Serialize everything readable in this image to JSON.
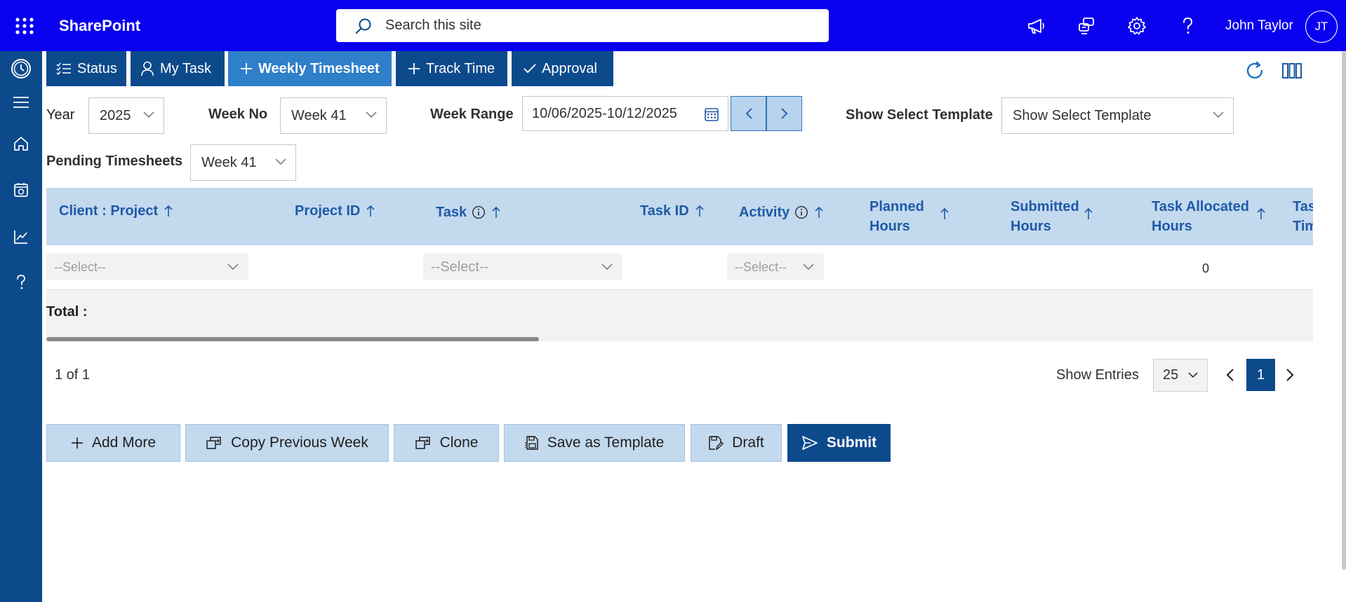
{
  "header": {
    "brand": "SharePoint",
    "search_placeholder": "Search this site",
    "user_name": "John Taylor",
    "user_initials": "JT"
  },
  "tabs": [
    {
      "label": "Status",
      "icon": "checklist-icon",
      "active": false
    },
    {
      "label": "My Task",
      "icon": "person-icon",
      "active": false
    },
    {
      "label": "Weekly Timesheet",
      "icon": "plus-icon",
      "active": true
    },
    {
      "label": "Track Time",
      "icon": "plus-icon",
      "active": false
    },
    {
      "label": "Approval",
      "icon": "checkmark-icon",
      "active": false
    }
  ],
  "filters": {
    "year_label": "Year",
    "year_value": "2025",
    "week_no_label": "Week No",
    "week_no_value": "Week 41",
    "week_range_label": "Week Range",
    "week_range_value": "10/06/2025-10/12/2025",
    "template_label": "Show Select Template",
    "template_value": "Show Select Template",
    "pending_label": "Pending Timesheets",
    "pending_value": "Week 41"
  },
  "grid": {
    "columns": [
      "Client : Project",
      "Project ID",
      "Task",
      "Task ID",
      "Activity",
      "Planned Hours",
      "Submitted Hours",
      "Task Allocated Hours",
      "Task Time"
    ],
    "column_lines": {
      "planned": [
        "Planned",
        "Hours"
      ],
      "submitted": [
        "Submitted",
        "Hours"
      ],
      "allocated": [
        "Task Allocated",
        "Hours"
      ],
      "cut": [
        "Tas",
        "Tim"
      ]
    },
    "row": {
      "client_project_placeholder": "--Select--",
      "task_placeholder": "--Select--",
      "activity_placeholder": "--Select--",
      "task_allocated_hours": "0"
    },
    "total_label": "Total :"
  },
  "pager": {
    "page_info": "1 of 1",
    "show_entries_label": "Show Entries",
    "entries_value": "25",
    "current_page": "1"
  },
  "actions": {
    "add_more": "Add More",
    "copy_previous_week": "Copy Previous Week",
    "clone": "Clone",
    "save_as_template": "Save as Template",
    "draft": "Draft",
    "submit": "Submit"
  },
  "colors": {
    "suite_bar": "#0a00f0",
    "nav_blue": "#0d4a8c",
    "active_tab": "#2f7fc9",
    "grid_header": "#c3d9ee",
    "header_text": "#1e5aa6"
  }
}
